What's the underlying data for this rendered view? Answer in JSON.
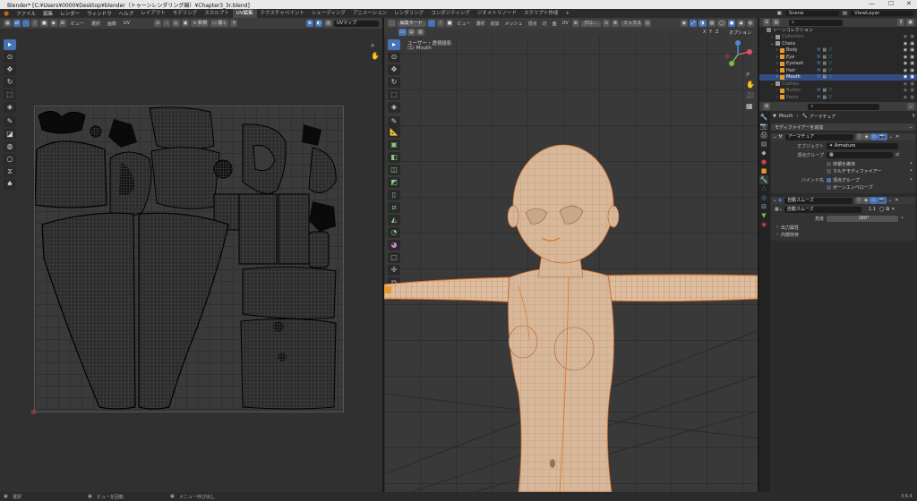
{
  "titlebar": {
    "title": "Blender* [C:¥Users¥0000¥Desktop¥blender（トゥーンレンダリング編）¥Chapter3_3r.blend]",
    "minimize": "—",
    "maximize": "☐",
    "close": "✕"
  },
  "menus": [
    "ファイル",
    "編集",
    "レンダー",
    "ウィンドウ",
    "ヘルプ"
  ],
  "workspaces": [
    "レイアウト",
    "モデリング",
    "スカルプト",
    "UV編集",
    "テクスチャペイント",
    "シェーディング",
    "アニメーション",
    "レンダリング",
    "コンポジティング",
    "ジオメトリノード",
    "スクリプト作成"
  ],
  "workspace_active": "UV編集",
  "workspace_add": "+",
  "scene": {
    "label": "Scene",
    "viewlayer": "ViewLayer"
  },
  "uv_editor": {
    "header_menus": [
      "ビュー",
      "選択",
      "画像",
      "UV"
    ],
    "new_btn": "新規",
    "open_btn": "開く",
    "uvmap": "UVマップ"
  },
  "viewport": {
    "mode": "編集モード",
    "header_menus": [
      "ビュー",
      "選択",
      "追加",
      "メッシュ",
      "頂点",
      "辺",
      "面",
      "UV"
    ],
    "transform": "グロ...",
    "snap": "ミックス",
    "options": "オプション",
    "view_name": "ユーザー・透視投影",
    "object_name": "(1) Mouth",
    "axes": [
      "X",
      "Y",
      "Z"
    ]
  },
  "outliner": {
    "header": "シーンコレクション",
    "rows": [
      {
        "indent": 0,
        "name": "Collection",
        "dim": true
      },
      {
        "indent": 0,
        "name": "Chara",
        "dim": false
      },
      {
        "indent": 1,
        "name": "Body",
        "dim": false,
        "sel": false
      },
      {
        "indent": 1,
        "name": "Eye",
        "dim": false,
        "sel": false
      },
      {
        "indent": 1,
        "name": "Eyelash",
        "dim": false,
        "sel": false
      },
      {
        "indent": 1,
        "name": "Hair",
        "dim": false,
        "sel": false
      },
      {
        "indent": 1,
        "name": "Mouth",
        "dim": false,
        "sel": true
      },
      {
        "indent": 0,
        "name": "Clothes",
        "dim": true
      },
      {
        "indent": 1,
        "name": "Button",
        "dim": true
      },
      {
        "indent": 1,
        "name": "Pants",
        "dim": true
      }
    ]
  },
  "properties": {
    "breadcrumb_obj": "Mouth",
    "breadcrumb_mod": "アーマチュア",
    "add_modifier": "モディファイアーを追加",
    "armature": {
      "name": "アーマチュア",
      "object_label": "オブジェクト",
      "object_value": "Armature",
      "vgroup_label": "頂点グループ",
      "keep_volume": "体積を維持",
      "multi_modifier": "マルチモディファイアー",
      "bind_label": "バインド先",
      "bind_vgroups": "頂点グループ",
      "bind_envelope": "ボーンエンベロープ"
    },
    "smooth": {
      "name": "自動スムーズ",
      "sub_name": "自動スムーズ",
      "sub_value": "1.1",
      "angle_label": "角度",
      "angle_value": "180°",
      "output": "出力属性",
      "internal": "内部依存"
    }
  },
  "status": {
    "left": "選択",
    "mid": "ビューを回転",
    "right": "メニュー呼び出し",
    "version": "3.6.4"
  }
}
